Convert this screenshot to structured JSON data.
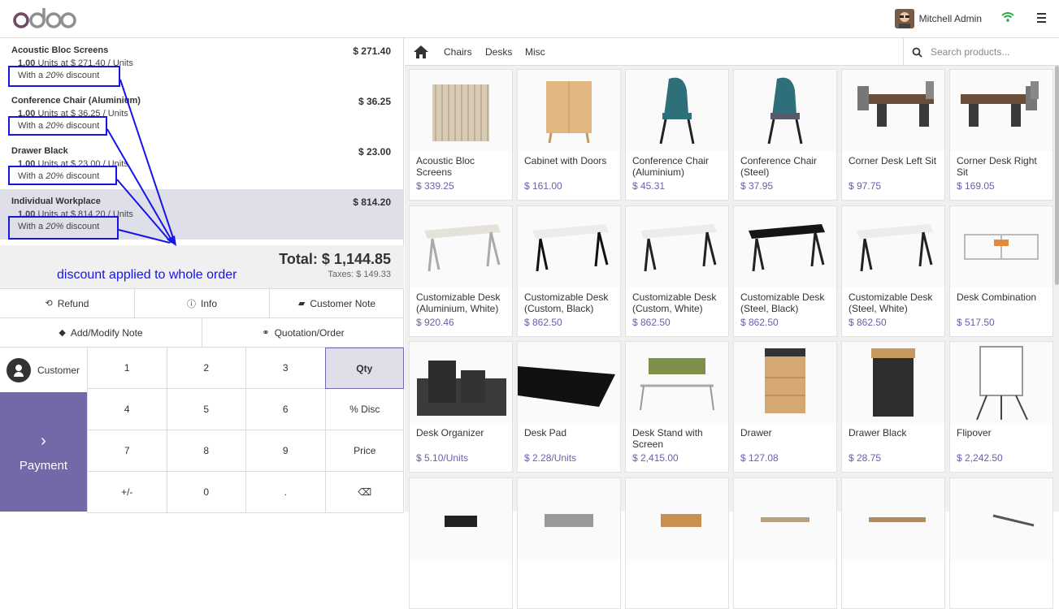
{
  "app": {
    "logo": "odoo"
  },
  "user": {
    "name": "Mitchell Admin"
  },
  "order_lines": [
    {
      "name": "Acoustic Bloc Screens",
      "price": "$ 271.40",
      "qty": "1.00",
      "info": " Units at $ 271.40 / Units",
      "discount_prefix": "With a ",
      "discount_value": "20%",
      "discount_suffix": " discount",
      "selected": false
    },
    {
      "name": "Conference Chair (Aluminium)",
      "price": "$ 36.25",
      "qty": "1.00",
      "info": " Units at $ 36.25 / Units",
      "discount_prefix": "With a ",
      "discount_value": "20%",
      "discount_suffix": " discount",
      "selected": false
    },
    {
      "name": "Drawer Black",
      "price": "$ 23.00",
      "qty": "1.00",
      "info": " Units at $ 23.00 / Units",
      "discount_prefix": "With a ",
      "discount_value": "20%",
      "discount_suffix": " discount",
      "selected": false
    },
    {
      "name": "Individual Workplace",
      "price": "$ 814.20",
      "qty": "1.00",
      "info": " Units at $ 814.20 / Units",
      "discount_prefix": "With a ",
      "discount_value": "20%",
      "discount_suffix": " discount",
      "selected": true
    }
  ],
  "summary": {
    "total": "Total: $ 1,144.85",
    "taxes": "Taxes: $ 149.33"
  },
  "annotation": {
    "text": "discount applied to whole order",
    "color": "#1515e6"
  },
  "controls_row1": [
    "Refund",
    "Info",
    "Customer Note"
  ],
  "controls_row2": [
    "Add/Modify Note",
    "Quotation/Order"
  ],
  "customer_label": "Customer",
  "payment_label": "Payment",
  "numpad": [
    "1",
    "2",
    "3",
    "Qty",
    "4",
    "5",
    "6",
    "% Disc",
    "7",
    "8",
    "9",
    "Price",
    "+/-",
    "0",
    ".",
    "⌫"
  ],
  "numpad_active": "Qty",
  "categories": [
    "Chairs",
    "Desks",
    "Misc"
  ],
  "search": {
    "placeholder": "Search products..."
  },
  "products": [
    {
      "name": "Acoustic Bloc Screens",
      "price": "$ 339.25"
    },
    {
      "name": "Cabinet with Doors",
      "price": "$ 161.00"
    },
    {
      "name": "Conference Chair (Aluminium)",
      "price": "$ 45.31"
    },
    {
      "name": "Conference Chair (Steel)",
      "price": "$ 37.95"
    },
    {
      "name": "Corner Desk Left Sit",
      "price": "$ 97.75"
    },
    {
      "name": "Corner Desk Right Sit",
      "price": "$ 169.05"
    },
    {
      "name": "Customizable Desk (Aluminium, White)",
      "price": "$ 920.46"
    },
    {
      "name": "Customizable Desk (Custom, Black)",
      "price": "$ 862.50"
    },
    {
      "name": "Customizable Desk (Custom, White)",
      "price": "$ 862.50"
    },
    {
      "name": "Customizable Desk (Steel, Black)",
      "price": "$ 862.50"
    },
    {
      "name": "Customizable Desk (Steel, White)",
      "price": "$ 862.50"
    },
    {
      "name": "Desk Combination",
      "price": "$ 517.50"
    },
    {
      "name": "Desk Organizer",
      "price": "$ 5.10/Units"
    },
    {
      "name": "Desk Pad",
      "price": "$ 2.28/Units"
    },
    {
      "name": "Desk Stand with Screen",
      "price": "$ 2,415.00"
    },
    {
      "name": "Drawer",
      "price": "$ 127.08"
    },
    {
      "name": "Drawer Black",
      "price": "$ 28.75"
    },
    {
      "name": "Flipover",
      "price": "$ 2,242.50"
    },
    {
      "name": "",
      "price": ""
    },
    {
      "name": "",
      "price": ""
    },
    {
      "name": "",
      "price": ""
    },
    {
      "name": "",
      "price": ""
    },
    {
      "name": "",
      "price": ""
    },
    {
      "name": "",
      "price": ""
    }
  ],
  "colors": {
    "accent": "#7368a8",
    "price": "#6a5fa8",
    "selected_bg": "#dfdfea"
  }
}
